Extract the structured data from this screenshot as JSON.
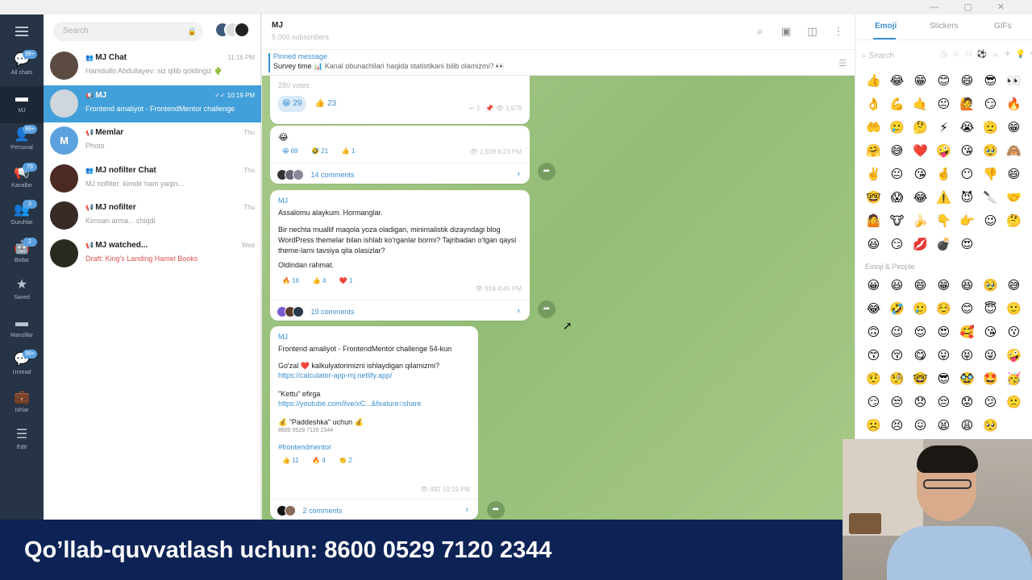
{
  "window": {
    "controls": "— ▢ ✕"
  },
  "rail": {
    "items": [
      {
        "label": "All chats",
        "badge": "99+",
        "icon": "chat-bubbles-icon"
      },
      {
        "label": "MJ",
        "badge": "",
        "icon": "folder-icon",
        "active": true
      },
      {
        "label": "Personal",
        "badge": "99+",
        "icon": "person-icon"
      },
      {
        "label": "Kanallar",
        "badge": "79",
        "icon": "channel-icon"
      },
      {
        "label": "Guruhlar",
        "badge": "3",
        "icon": "group-icon"
      },
      {
        "label": "Botlar",
        "badge": "2",
        "icon": "bot-icon"
      },
      {
        "label": "Saved",
        "badge": "",
        "icon": "star-icon"
      },
      {
        "label": "Manzillar",
        "badge": "",
        "icon": "folder-icon"
      },
      {
        "label": "Unread",
        "badge": "99+",
        "icon": "chat-icon"
      },
      {
        "label": "Ishlar",
        "badge": "",
        "icon": "briefcase-icon"
      },
      {
        "label": "Edit",
        "badge": "",
        "icon": "sliders-icon"
      }
    ]
  },
  "chatlist": {
    "search_placeholder": "Search",
    "chats": [
      {
        "name": "MJ Chat",
        "time": "11:16 PM",
        "preview": "Hamdullo Abdullayev: siz qilib qoldingiz 🌵",
        "type": "group"
      },
      {
        "name": "MJ",
        "time": "✓✓ 10:19 PM",
        "preview": "Frontend amaliyot - FrontendMentor challenge",
        "type": "channel",
        "active": true
      },
      {
        "name": "Memlar",
        "time": "Thu",
        "preview": "Photo",
        "type": "channel",
        "letter": "M"
      },
      {
        "name": "MJ nofilter Chat",
        "time": "Thu",
        "preview": "MJ nofilter: kimdir ham yaqin...",
        "type": "group"
      },
      {
        "name": "MJ nofilter",
        "time": "Thu",
        "preview": "Kimsan arma... chiqdi",
        "type": "channel"
      },
      {
        "name": "MJ watched...",
        "time": "Wed",
        "preview": "Draft: King's Landing Hamel Books",
        "type": "channel",
        "draft": true
      }
    ]
  },
  "header": {
    "title": "MJ",
    "subtitle": "5,000 subscribers",
    "icons": [
      "search-icon",
      "live-icon",
      "sidebar-icon",
      "more-icon"
    ]
  },
  "pinned": {
    "label": "Pinned message",
    "text_prefix": "Survey time",
    "text": "Kanal obunachilari haqida statistikani bilib olamizmi? 👀"
  },
  "messages": [
    {
      "id": "msg1",
      "tail_text": "280 votes",
      "reactions_big": [
        {
          "emoji": "😁",
          "count": "29"
        },
        {
          "emoji": "👍",
          "count": "23"
        }
      ],
      "views": "1,979"
    },
    {
      "id": "msg2",
      "emoji": "😂",
      "reactions": [
        {
          "emoji": "😁",
          "count": "69"
        },
        {
          "emoji": "🤣",
          "count": "21"
        },
        {
          "emoji": "👍",
          "count": "1"
        }
      ],
      "views": "1,928",
      "time": "6:23 PM",
      "comments": "14 comments"
    },
    {
      "id": "msg3",
      "author": "MJ",
      "p1": "Assalomu alaykum. Hormanglar.",
      "p2": "Bir nechta muallif maqola yoza oladigan, minimalistik dizayndagi blog WordPress themelar bilan ishlab ko'rganlar bormi? Tajribadan o'tgan qaysi theme-larni tavsiya qila olasizlar?",
      "p3": "Oldindan rahmat.",
      "reactions": [
        {
          "emoji": "🔥",
          "count": "16"
        },
        {
          "emoji": "👍",
          "count": "4"
        },
        {
          "emoji": "❤️",
          "count": "1"
        }
      ],
      "views": "918",
      "time": "4:45 PM",
      "comments": "19 comments"
    },
    {
      "id": "msg4",
      "author": "MJ",
      "title": "Frontend amaliyot - FrontendMentor challenge 54-kun",
      "p1": "Go'zal ❤️ kalkulyatorimizni ishlaydigan qilamizmi?",
      "link1": "https://calculator-app-mj.netlify.app/",
      "p2": "\"Kettu\" efirga",
      "link2": "https://youtube.com/live/xC...&feature=share",
      "p3": "💰 \"Paddeshka\" uchun 💰",
      "card": "8600 0529 7120 2344",
      "hashtag": "#frontendmentor",
      "reactions": [
        {
          "emoji": "👍",
          "count": "11"
        },
        {
          "emoji": "🔥",
          "count": "4"
        },
        {
          "emoji": "👏",
          "count": "2"
        }
      ],
      "views": "492",
      "time": "10:19 PM",
      "comments": "2 comments"
    }
  ],
  "emoji_panel": {
    "tabs": [
      "Emoji",
      "Stickers",
      "GIFs"
    ],
    "search_placeholder": "Search",
    "section_label": "Emoji & People",
    "recent": [
      "👍",
      "😂",
      "😁",
      "😊",
      "😄",
      "😎",
      "👀",
      "👌",
      "💪",
      "🤙",
      "😐",
      "🙋",
      "😏",
      "🔥",
      "🤲",
      "🥲",
      "🤔",
      "⚡",
      "😭",
      "🫡",
      "😁",
      "🤗",
      "😅",
      "❤️",
      "🤪",
      "😘",
      "🥹",
      "🙈",
      "✌️",
      "😐",
      "😘",
      "🤞",
      "😶",
      "👎",
      "😄",
      "🤓",
      "😱",
      "😂",
      "⚠️",
      "😈",
      "🔪",
      "🤝",
      "🤷",
      "🐮",
      "🍌",
      "👇",
      "👉",
      "😉",
      "🤔",
      "😃",
      "😏",
      "💋",
      "💣",
      "😍"
    ],
    "people": [
      "😀",
      "😃",
      "😄",
      "😁",
      "😆",
      "🥹",
      "😅",
      "😂",
      "🤣",
      "🥲",
      "☺️",
      "😊",
      "😇",
      "🙂",
      "🙃",
      "😉",
      "😌",
      "😍",
      "🥰",
      "😘",
      "😗",
      "😙",
      "😚",
      "😋",
      "😛",
      "😝",
      "😜",
      "🤪",
      "🤨",
      "🧐",
      "🤓",
      "😎",
      "🥸",
      "🤩",
      "🥳",
      "😏",
      "😒",
      "😞",
      "😔",
      "😟",
      "😕",
      "🙁",
      "☹️",
      "😣",
      "😖",
      "😫",
      "😩",
      "🥺"
    ]
  },
  "banner": {
    "text": "Qo’llab-quvvatlash uchun: 8600 0529 7120 2344"
  }
}
